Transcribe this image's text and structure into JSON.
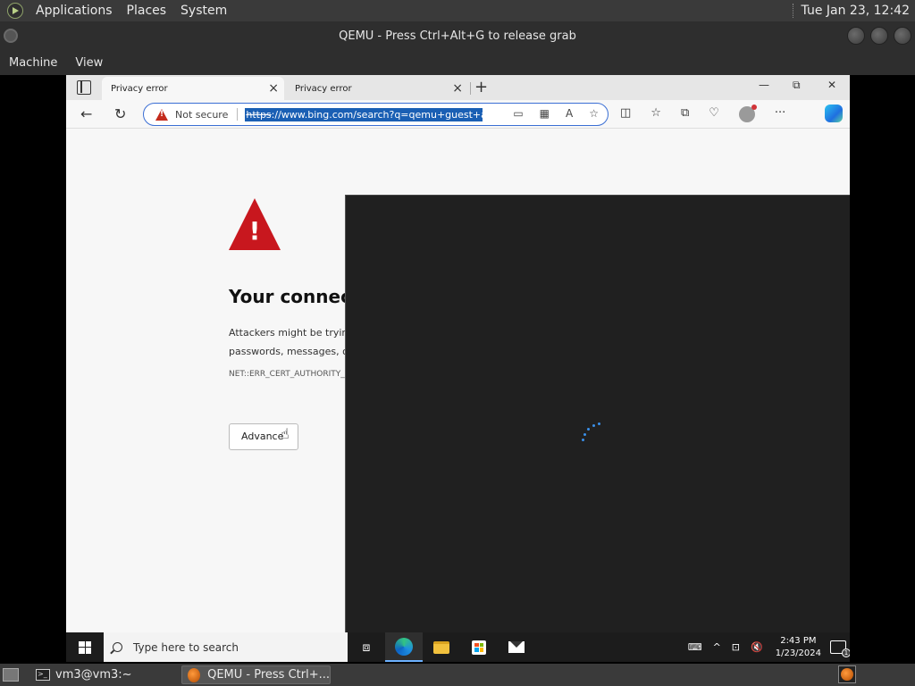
{
  "top_panel": {
    "menus": [
      "Applications",
      "Places",
      "System"
    ],
    "clock": "Tue Jan 23, 12:42"
  },
  "qemu": {
    "title": "QEMU - Press Ctrl+Alt+G to release grab",
    "menus": [
      "Machine",
      "View"
    ]
  },
  "edge": {
    "tabs": [
      {
        "label": "Privacy error",
        "active": true
      },
      {
        "label": "Privacy error",
        "active": false
      }
    ],
    "window_controls": {
      "minimize": "—",
      "restore": "⧉",
      "close": "✕"
    },
    "address": {
      "security_label": "Not secure",
      "url_scheme": "https",
      "url_rest": "://www.bing.com/search?q=qemu+guest+ag"
    }
  },
  "page": {
    "title": "Your connecti",
    "body_line1": "Attackers might be trying",
    "body_line2": "passwords, messages, or",
    "error_code": "NET::ERR_CERT_AUTHORITY_",
    "advanced_label": "Advance"
  },
  "overlay": {
    "background": "#202020",
    "spinner_color": "#3a8fe8"
  },
  "windows_taskbar": {
    "search_placeholder": "Type here to search",
    "time": "2:43 PM",
    "date": "1/23/2024",
    "notification_count": "1"
  },
  "bottom_panel": {
    "tasks": [
      "vm3@vm3:~",
      "QEMU - Press Ctrl+..."
    ]
  },
  "colors": {
    "accent": "#3b6fd4",
    "url_highlight": "#1a5fb4",
    "warning_red": "#c8171e"
  }
}
